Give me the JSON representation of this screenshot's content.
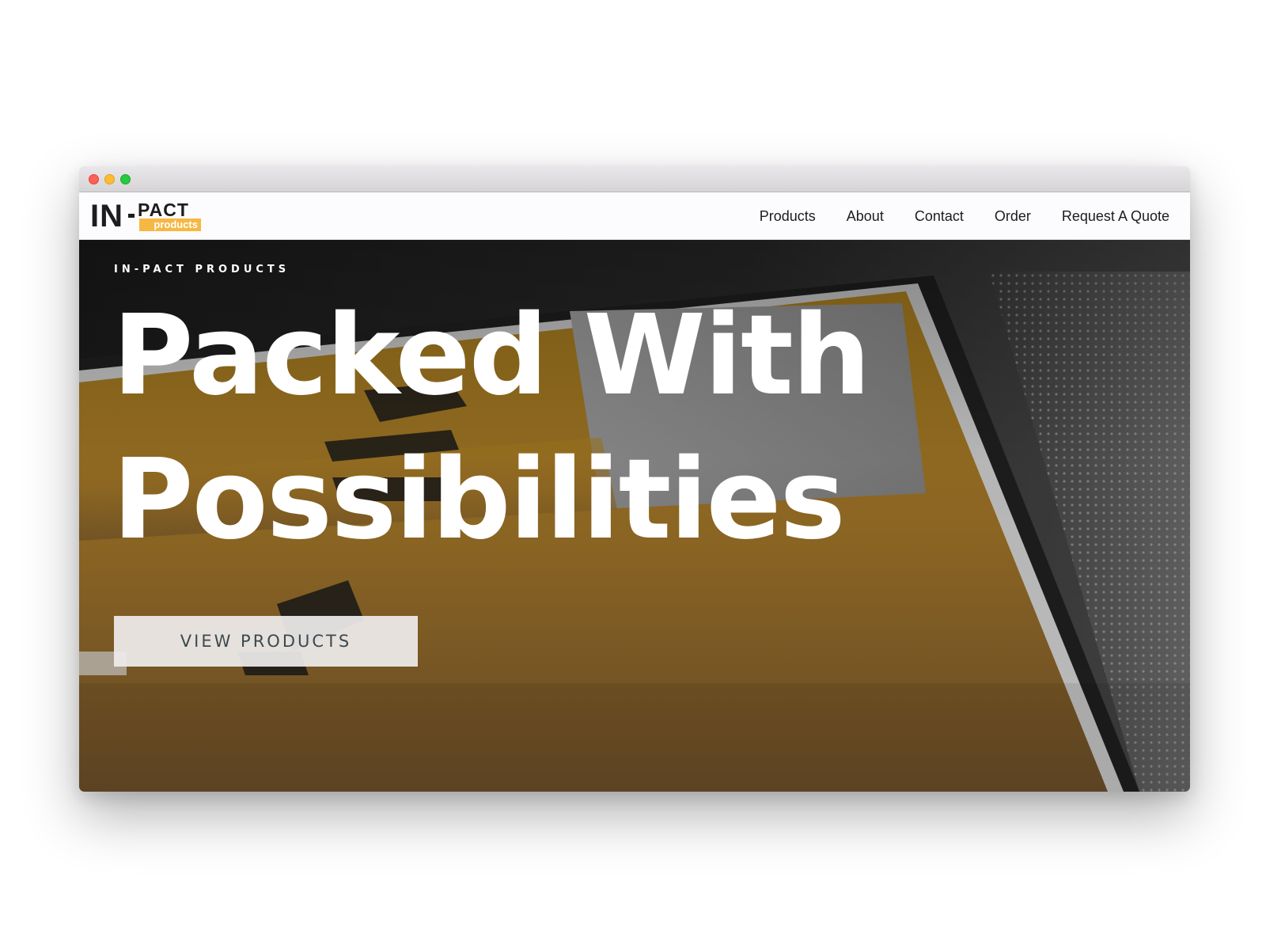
{
  "window": {
    "controls": [
      "close",
      "minimize",
      "maximize"
    ],
    "colors": {
      "close": "#fe5f57",
      "minimize": "#febc2e",
      "maximize": "#28c840"
    }
  },
  "header": {
    "logo": {
      "main": "IN",
      "pact": "PACT",
      "tag": "products",
      "tag_color": "#f5b843"
    },
    "nav": [
      {
        "label": "Products"
      },
      {
        "label": "About"
      },
      {
        "label": "Contact"
      },
      {
        "label": "Order"
      },
      {
        "label": "Request A Quote"
      }
    ]
  },
  "hero": {
    "kicker": "IN-PACT PRODUCTS",
    "title_line1": "Packed With",
    "title_line2": "Possibilities",
    "button_label": "VIEW PRODUCTS",
    "accent_color": "#c8962a"
  }
}
